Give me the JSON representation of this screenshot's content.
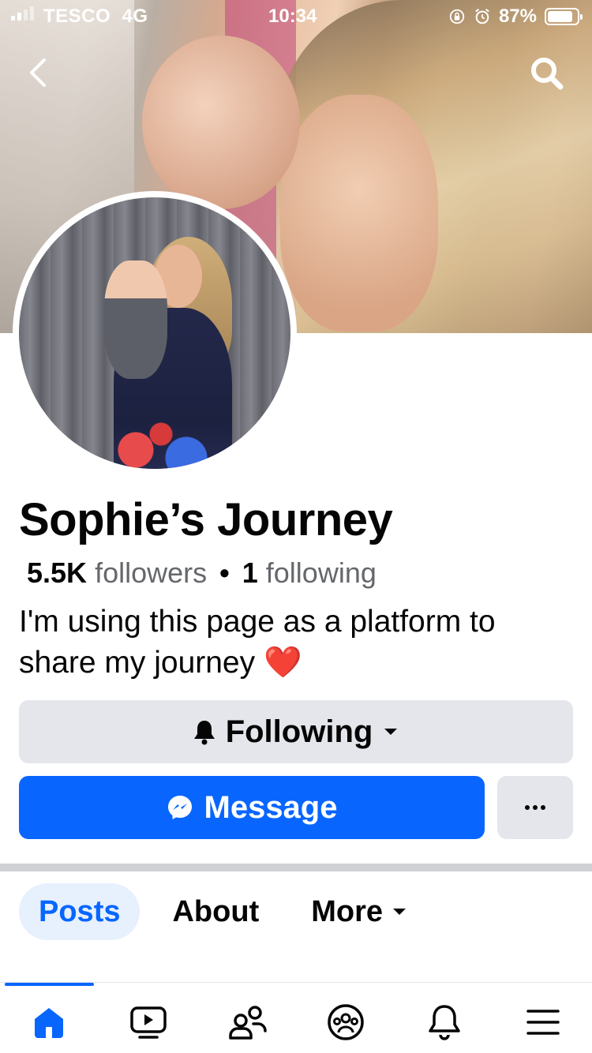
{
  "status_bar": {
    "carrier": "TESCO",
    "network": "4G",
    "time": "10:34",
    "battery": "87%"
  },
  "header": {
    "back_icon": "chevron-left-icon",
    "search_icon": "search-icon"
  },
  "profile": {
    "name": "Sophie’s Journey",
    "followers_count": "5.5K",
    "followers_label": "followers",
    "separator": "•",
    "following_count": "1",
    "following_label": "following",
    "bio": "I'm using this page as a platform to share my journey",
    "bio_emoji": "❤️"
  },
  "actions": {
    "following_label": "Following",
    "message_label": "Message",
    "more_label": "···"
  },
  "tabs": [
    {
      "label": "Posts",
      "active": true
    },
    {
      "label": "About",
      "active": false
    },
    {
      "label": "More",
      "active": false
    }
  ],
  "bottom_nav": {
    "items": [
      "home-icon",
      "video-icon",
      "friends-icon",
      "groups-icon",
      "notifications-icon",
      "menu-icon"
    ],
    "active": "home-icon"
  },
  "colors": {
    "accent": "#0866ff",
    "button_gray": "#e4e6eb",
    "tab_active_bg": "#e7f0fd",
    "secondary_text": "#65676b"
  }
}
